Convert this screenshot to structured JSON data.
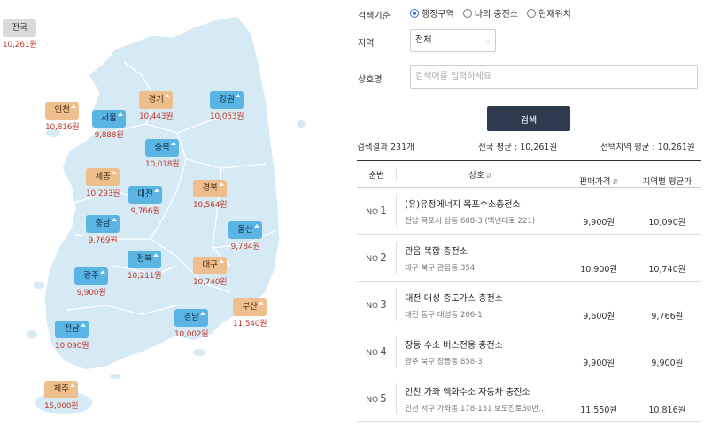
{
  "map": {
    "regions": [
      {
        "id": "national",
        "name": "전국",
        "price": "10,261원",
        "style": "gray"
      },
      {
        "id": "incheon",
        "name": "인천",
        "price": "10,816원",
        "style": "tan"
      },
      {
        "id": "seoul",
        "name": "서울",
        "price": "9,888원",
        "style": "blue"
      },
      {
        "id": "gyeonggi",
        "name": "경기",
        "price": "10,443원",
        "style": "tan"
      },
      {
        "id": "gangwon",
        "name": "강원",
        "price": "10,053원",
        "style": "blue"
      },
      {
        "id": "chungbuk",
        "name": "충북",
        "price": "10,018원",
        "style": "blue"
      },
      {
        "id": "sejong",
        "name": "세종",
        "price": "10,293원",
        "style": "tan"
      },
      {
        "id": "daejeon",
        "name": "대전",
        "price": "9,766원",
        "style": "blue"
      },
      {
        "id": "gyeongbuk",
        "name": "경북",
        "price": "10,564원",
        "style": "tan"
      },
      {
        "id": "chungnam",
        "name": "충남",
        "price": "9,769원",
        "style": "blue"
      },
      {
        "id": "ulsan",
        "name": "울산",
        "price": "9,784원",
        "style": "blue"
      },
      {
        "id": "jeonbuk",
        "name": "전북",
        "price": "10,211원",
        "style": "blue"
      },
      {
        "id": "daegu",
        "name": "대구",
        "price": "10,740원",
        "style": "tan"
      },
      {
        "id": "gwangju",
        "name": "광주",
        "price": "9,900원",
        "style": "blue"
      },
      {
        "id": "busan",
        "name": "부산",
        "price": "11,540원",
        "style": "tan"
      },
      {
        "id": "gyeongnam",
        "name": "경남",
        "price": "10,002원",
        "style": "blue"
      },
      {
        "id": "jeonnam",
        "name": "전남",
        "price": "10,090원",
        "style": "blue"
      },
      {
        "id": "jeju",
        "name": "제주",
        "price": "15,000원",
        "style": "tan"
      }
    ]
  },
  "search": {
    "criteria_label": "검색기준",
    "criteria_options": [
      "행정구역",
      "나의 충전소",
      "현재위치"
    ],
    "criteria_selected": 0,
    "region_label": "지역",
    "region_value": "전체",
    "name_label": "상호명",
    "name_placeholder": "검색어를 입력하세요",
    "button_label": "검색"
  },
  "summary": {
    "count": "검색결과 231개",
    "national_avg": "전국 평균 : 10,261원",
    "selected_avg": "선택지역 평균 : 10,261원"
  },
  "table": {
    "headers": {
      "no": "순번",
      "name": "상호",
      "price": "판매가격",
      "avg": "지역별 평균가"
    },
    "rows": [
      {
        "no_label": "NO",
        "no": "1",
        "name": "(유)유정에너지 목포수소충전소",
        "addr": "전남 목포시 상동 608-3 (백년대로 221)",
        "price": "9,900원",
        "avg": "10,090원"
      },
      {
        "no_label": "NO",
        "no": "2",
        "name": "관음 복합 충전소",
        "addr": "대구 북구 관음동 354",
        "price": "10,900원",
        "avg": "10,740원"
      },
      {
        "no_label": "NO",
        "no": "3",
        "name": "대전 대성 중도가스 충전소",
        "addr": "대전 동구 대성동 206-1",
        "price": "9,600원",
        "avg": "9,766원"
      },
      {
        "no_label": "NO",
        "no": "4",
        "name": "장등 수소 버스전용 충전소",
        "addr": "광주 북구 장등동 858-3",
        "price": "9,900원",
        "avg": "9,900원"
      },
      {
        "no_label": "NO",
        "no": "5",
        "name": "인천 가좌 액화수소 자동차 충전소",
        "addr": "인천 서구 가좌동 178-131 보도진로30번…",
        "price": "11,550원",
        "avg": "10,816원"
      }
    ]
  }
}
